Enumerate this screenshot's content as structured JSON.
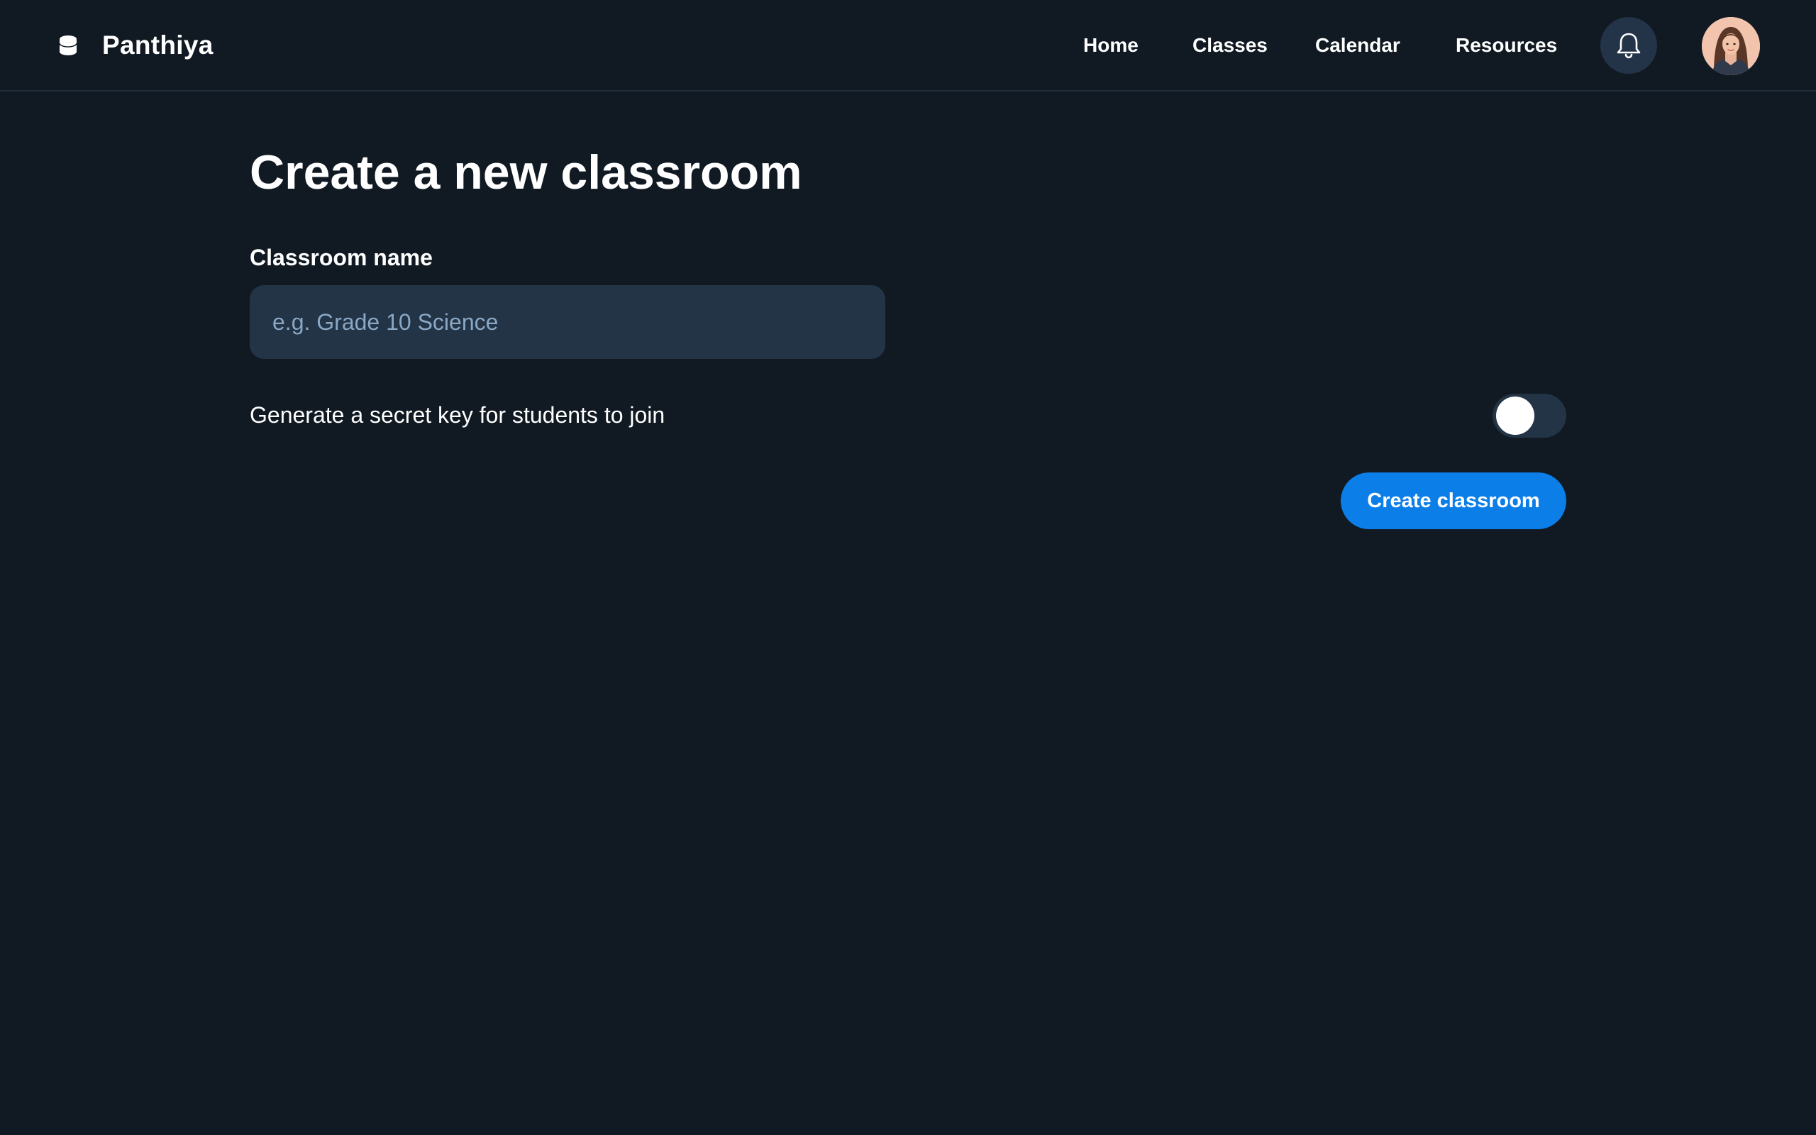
{
  "app": {
    "name": "Panthiya",
    "logo_icon": "database-icon"
  },
  "nav": {
    "items": [
      {
        "label": "Home"
      },
      {
        "label": "Classes"
      },
      {
        "label": "Calendar"
      },
      {
        "label": "Resources"
      }
    ],
    "notification_icon": "bell-icon",
    "avatar_icon": "user-avatar"
  },
  "page": {
    "title": "Create a new classroom"
  },
  "form": {
    "name_label": "Classroom name",
    "name_placeholder": "e.g. Grade 10 Science",
    "name_value": "",
    "secret_key_label": "Generate a secret key for students to join",
    "secret_key_enabled": false,
    "submit_label": "Create classroom"
  },
  "colors": {
    "background": "#111a23",
    "surface": "#223446",
    "accent": "#0c7ee8",
    "placeholder": "#8aa7c5"
  }
}
